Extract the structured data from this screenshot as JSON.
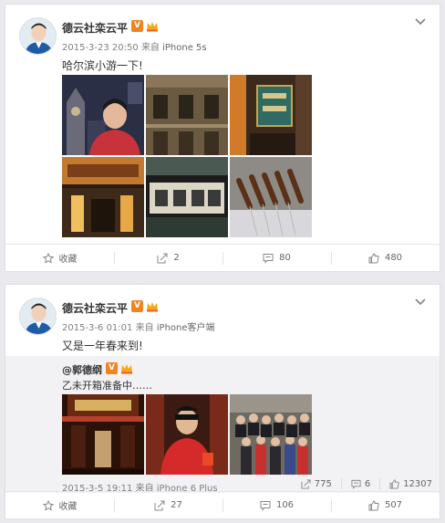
{
  "posts": [
    {
      "author": "德云社栾云平",
      "time": "2015-3-23 20:50",
      "source_prefix": "来自",
      "source": "iPhone 5s",
      "text": "哈尔滨小游一下!",
      "actions": {
        "favorite": "收藏",
        "repost": "2",
        "comment": "80",
        "like": "480"
      }
    },
    {
      "author": "德云社栾云平",
      "time": "2015-3-6 01:01",
      "source_prefix": "来自",
      "source": "iPhone客户端",
      "text": "又是一年春来到!",
      "repost": {
        "author": "@郭德纲",
        "text": "乙未开箱准备中……",
        "time": "2015-3-5 19:11",
        "source_prefix": "来自",
        "source": "iPhone 6 Plus",
        "reposts": "775",
        "comments": "6",
        "likes": "12307"
      },
      "actions": {
        "favorite": "收藏",
        "repost": "27",
        "comment": "106",
        "like": "507"
      }
    }
  ],
  "colors": {
    "badge": "#f08520",
    "link": "#eb7350",
    "meta": "#808080"
  }
}
